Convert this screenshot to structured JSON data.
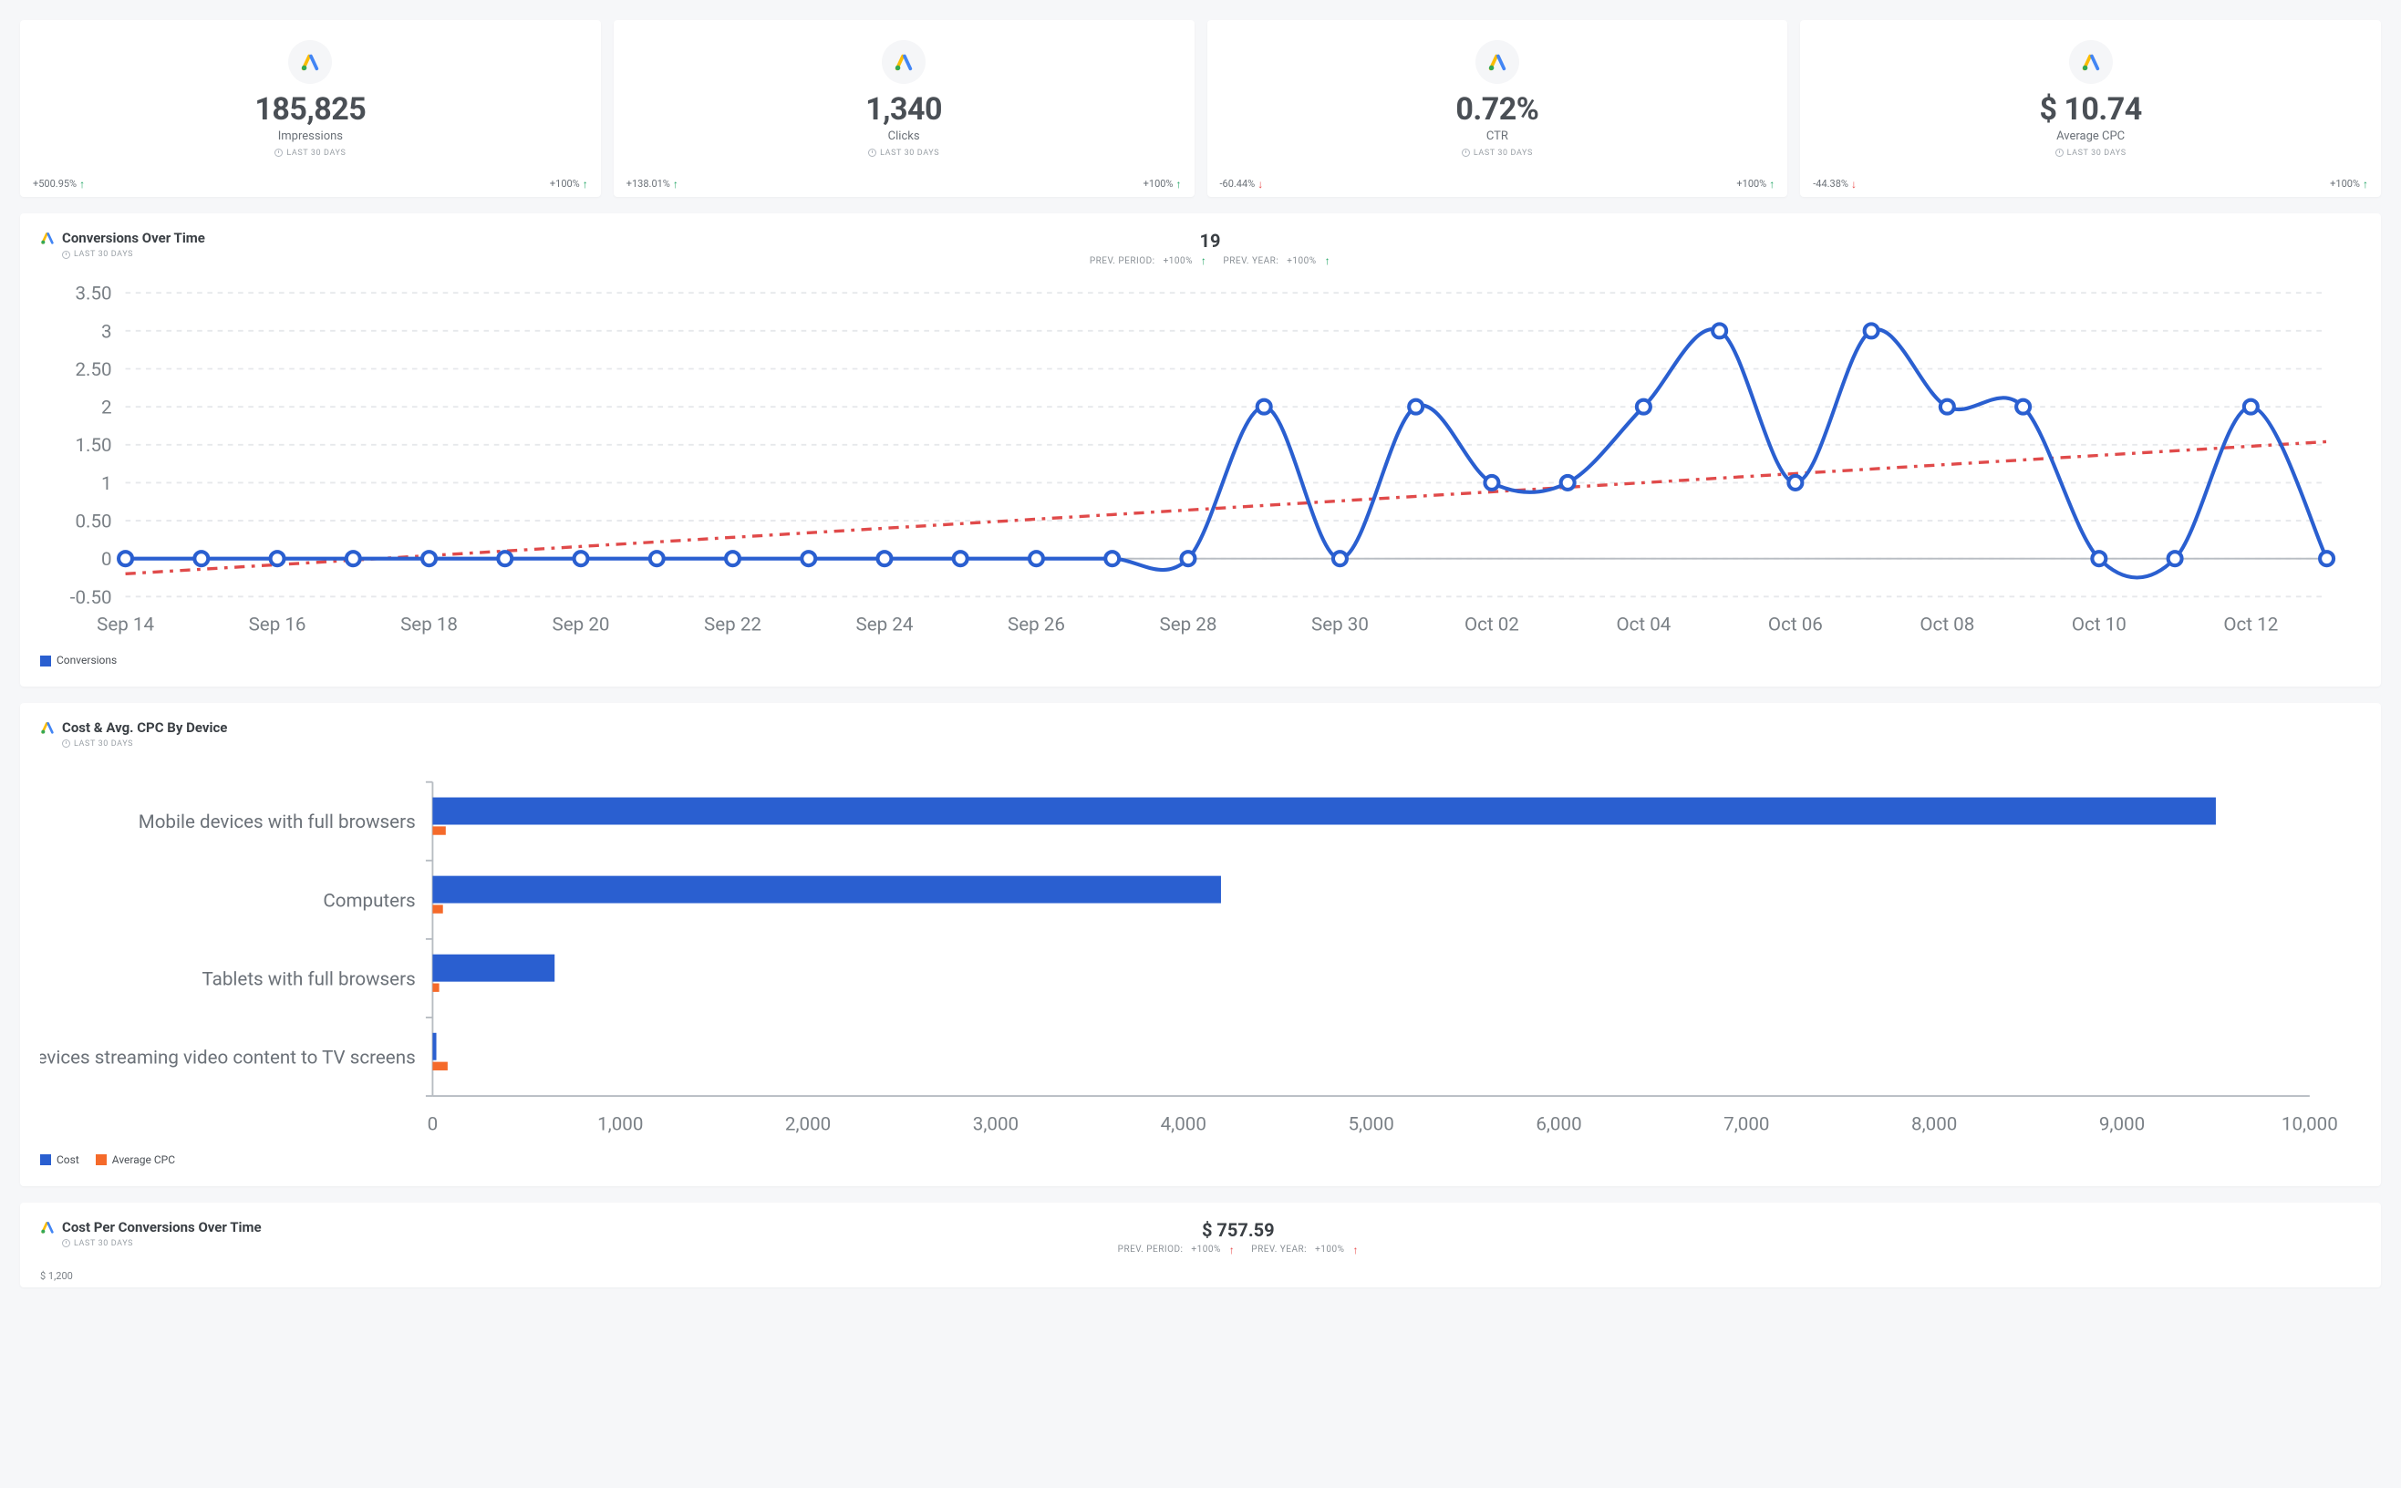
{
  "period_label": "LAST 30 DAYS",
  "kpis": [
    {
      "value": "185,825",
      "label": "Impressions",
      "left_delta": "+500.95%",
      "left_dir": "up",
      "right_delta": "+100%",
      "right_dir": "up"
    },
    {
      "value": "1,340",
      "label": "Clicks",
      "left_delta": "+138.01%",
      "left_dir": "up",
      "right_delta": "+100%",
      "right_dir": "up"
    },
    {
      "value": "0.72%",
      "label": "CTR",
      "left_delta": "-60.44%",
      "left_dir": "down",
      "right_delta": "+100%",
      "right_dir": "up"
    },
    {
      "value": "$ 10.74",
      "label": "Average CPC",
      "left_delta": "-44.38%",
      "left_dir": "down",
      "right_delta": "+100%",
      "right_dir": "up"
    }
  ],
  "conversions_panel": {
    "title": "Conversions Over Time",
    "big": "19",
    "prev_period": {
      "label": "PREV. PERIOD:",
      "delta": "+100%",
      "dir": "up"
    },
    "prev_year": {
      "label": "PREV. YEAR:",
      "delta": "+100%",
      "dir": "up"
    },
    "legend": "Conversions"
  },
  "device_panel": {
    "title": "Cost & Avg. CPC By Device",
    "legend_cost": "Cost",
    "legend_cpc": "Average CPC"
  },
  "cost_per_conv_panel": {
    "title": "Cost Per Conversions Over Time",
    "big": "$ 757.59",
    "prev_period": {
      "label": "PREV. PERIOD:",
      "delta": "+100%",
      "dir": "up"
    },
    "prev_year": {
      "label": "PREV. YEAR:",
      "delta": "+100%",
      "dir": "up"
    },
    "ylabel_peek": "$ 1,200"
  },
  "chart_data": [
    {
      "id": "conversions_over_time",
      "type": "line",
      "title": "Conversions Over Time",
      "xlabel": "",
      "ylabel": "",
      "ylim": [
        -0.5,
        3.5
      ],
      "y_ticks": [
        -0.5,
        0,
        0.5,
        1,
        1.5,
        2,
        2.5,
        3,
        3.5
      ],
      "x_ticks_shown": [
        "Sep 14",
        "Sep 16",
        "Sep 18",
        "Sep 20",
        "Sep 22",
        "Sep 24",
        "Sep 26",
        "Sep 28",
        "Sep 30",
        "Oct 02",
        "Oct 04",
        "Oct 06",
        "Oct 08",
        "Oct 10",
        "Oct 12"
      ],
      "categories": [
        "Sep 14",
        "Sep 15",
        "Sep 16",
        "Sep 17",
        "Sep 18",
        "Sep 19",
        "Sep 20",
        "Sep 21",
        "Sep 22",
        "Sep 23",
        "Sep 24",
        "Sep 25",
        "Sep 26",
        "Sep 27",
        "Sep 28",
        "Sep 29",
        "Sep 30",
        "Oct 01",
        "Oct 02",
        "Oct 03",
        "Oct 04",
        "Oct 05",
        "Oct 06",
        "Oct 07",
        "Oct 08",
        "Oct 09",
        "Oct 10",
        "Oct 11",
        "Oct 12",
        "Oct 13"
      ],
      "series": [
        {
          "name": "Conversions",
          "color": "#2a5fd0",
          "values": [
            0,
            0,
            0,
            0,
            0,
            0,
            0,
            0,
            0,
            0,
            0,
            0,
            0,
            0,
            0,
            2,
            0,
            2,
            1,
            1,
            2,
            3,
            1,
            3,
            2,
            2,
            0,
            0,
            2,
            0
          ]
        },
        {
          "name": "Trend",
          "color": "#e04a4a",
          "style": "dash-dot",
          "values": [
            -0.2,
            -0.14,
            -0.08,
            -0.02,
            0.04,
            0.1,
            0.16,
            0.22,
            0.28,
            0.34,
            0.4,
            0.46,
            0.52,
            0.58,
            0.64,
            0.7,
            0.76,
            0.82,
            0.88,
            0.94,
            1.0,
            1.06,
            1.12,
            1.18,
            1.24,
            1.3,
            1.36,
            1.42,
            1.48,
            1.54
          ]
        }
      ],
      "legend": [
        "Conversions"
      ],
      "total": 19
    },
    {
      "id": "cost_avg_cpc_by_device",
      "type": "bar",
      "orientation": "horizontal",
      "title": "Cost & Avg. CPC By Device",
      "xlabel": "",
      "ylabel": "",
      "xlim": [
        0,
        10000
      ],
      "x_ticks": [
        0,
        1000,
        2000,
        3000,
        4000,
        5000,
        6000,
        7000,
        8000,
        9000,
        10000
      ],
      "categories": [
        "Mobile devices with full browsers",
        "Computers",
        "Tablets with full browsers",
        "Devices streaming video content to TV screens"
      ],
      "series": [
        {
          "name": "Cost",
          "color": "#2a5fd0",
          "values": [
            9500,
            4200,
            650,
            20
          ]
        },
        {
          "name": "Average CPC",
          "color": "#f56a2a",
          "values": [
            70,
            55,
            35,
            80
          ]
        }
      ],
      "legend": [
        "Cost",
        "Average CPC"
      ]
    },
    {
      "id": "cost_per_conversions_over_time",
      "type": "line",
      "title": "Cost Per Conversions Over Time",
      "summary_value": "$ 757.59",
      "y_ticks_visible": [
        "$ 1,200"
      ],
      "note": "chart body cropped in screenshot"
    }
  ]
}
